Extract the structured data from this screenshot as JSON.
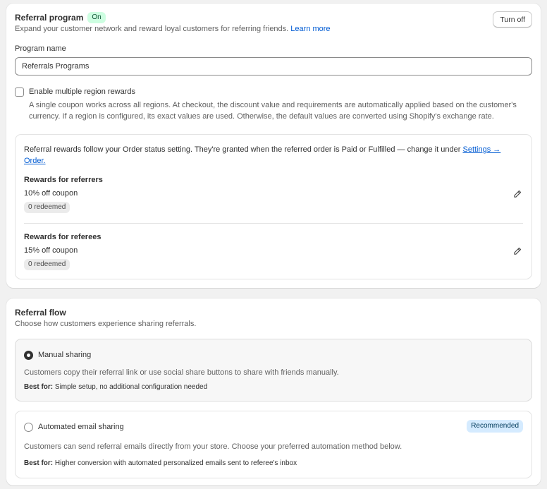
{
  "referral_program": {
    "title": "Referral program",
    "status_badge": "On",
    "description": "Expand your customer network and reward loyal customers for referring friends.",
    "learn_more": "Learn more",
    "turn_off_label": "Turn off",
    "program_name_label": "Program name",
    "program_name_value": "Referrals Programs",
    "multi_region_label": "Enable multiple region rewards",
    "multi_region_help": "A single coupon works across all regions. At checkout, the discount value and requirements are automatically applied based on the customer's currency. If a region is configured, its exact values are used. Otherwise, the default values are converted using Shopify's exchange rate.",
    "multi_region_checked": false
  },
  "rewards": {
    "info_text": "Referral rewards follow your Order status setting. They're granted when the referred order is Paid or Fulfilled — change it under",
    "info_link": "Settings → Order.",
    "referrers": {
      "title": "Rewards for referrers",
      "value": "10% off coupon",
      "redeemed": "0 redeemed"
    },
    "referees": {
      "title": "Rewards for referees",
      "value": "15% off coupon",
      "redeemed": "0 redeemed"
    }
  },
  "referral_flow": {
    "title": "Referral flow",
    "description": "Choose how customers experience sharing referrals.",
    "best_for_label": "Best for:",
    "options": [
      {
        "label": "Manual sharing",
        "selected": true,
        "description": "Customers copy their referral link or use social share buttons to share with friends manually.",
        "best_for": "Simple setup, no additional configuration needed"
      },
      {
        "label": "Automated email sharing",
        "selected": false,
        "badge": "Recommended",
        "description": "Customers can send referral emails directly from your store. Choose your preferred automation method below.",
        "best_for": "Higher conversion with automated personalized emails sent to referee's inbox"
      }
    ]
  },
  "colors": {
    "link": "#005bd3",
    "on_badge_bg": "#cdfee1",
    "recommended_badge_bg": "#d5ebff"
  },
  "icons": {
    "edit": "pencil-icon"
  }
}
